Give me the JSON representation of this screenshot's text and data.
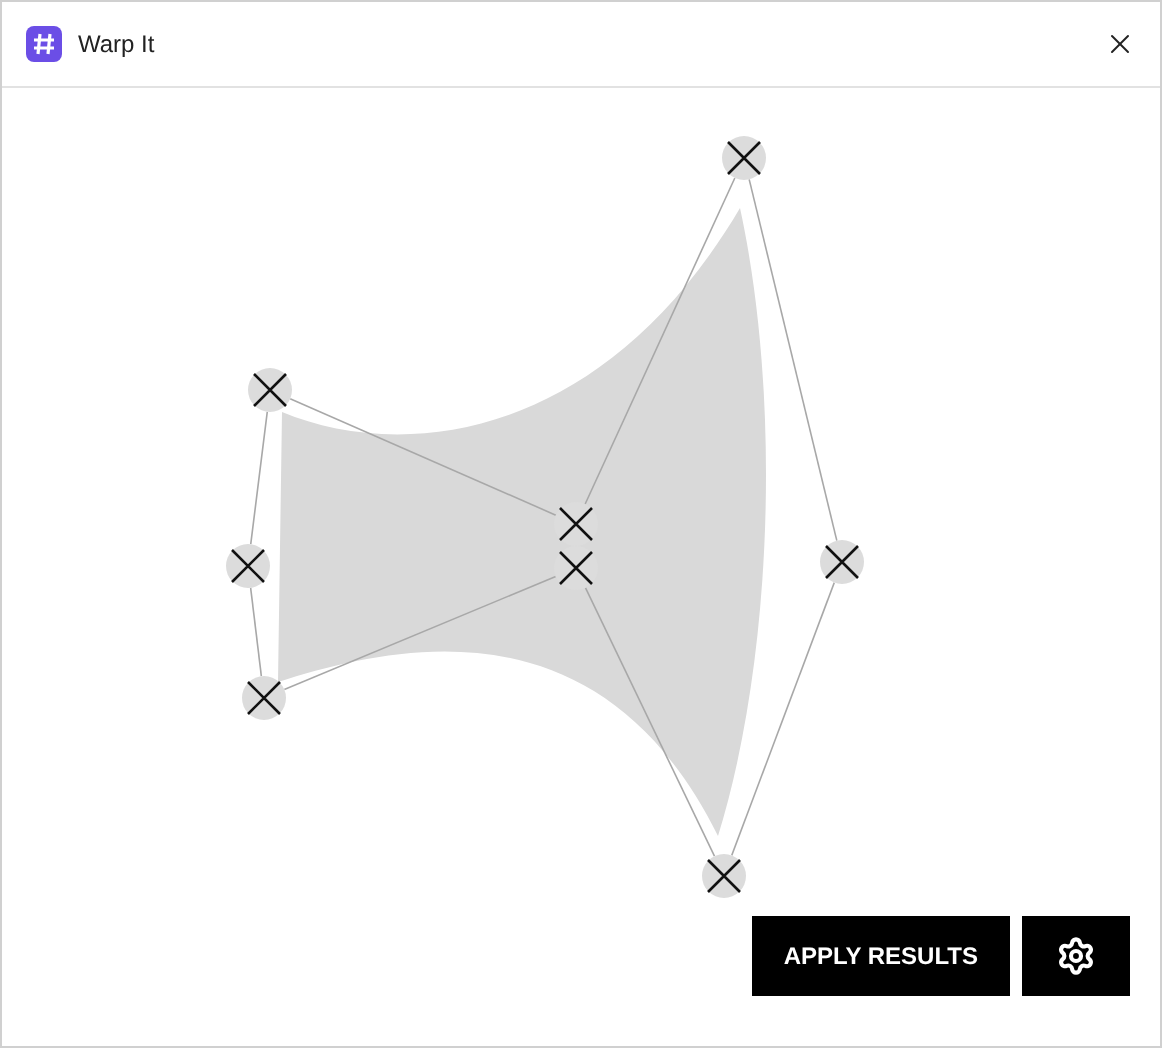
{
  "window": {
    "title": "Warp It"
  },
  "buttons": [
    {
      "kind": "text",
      "label": "APPLY RESULTS"
    },
    {
      "kind": "settings"
    }
  ]
}
